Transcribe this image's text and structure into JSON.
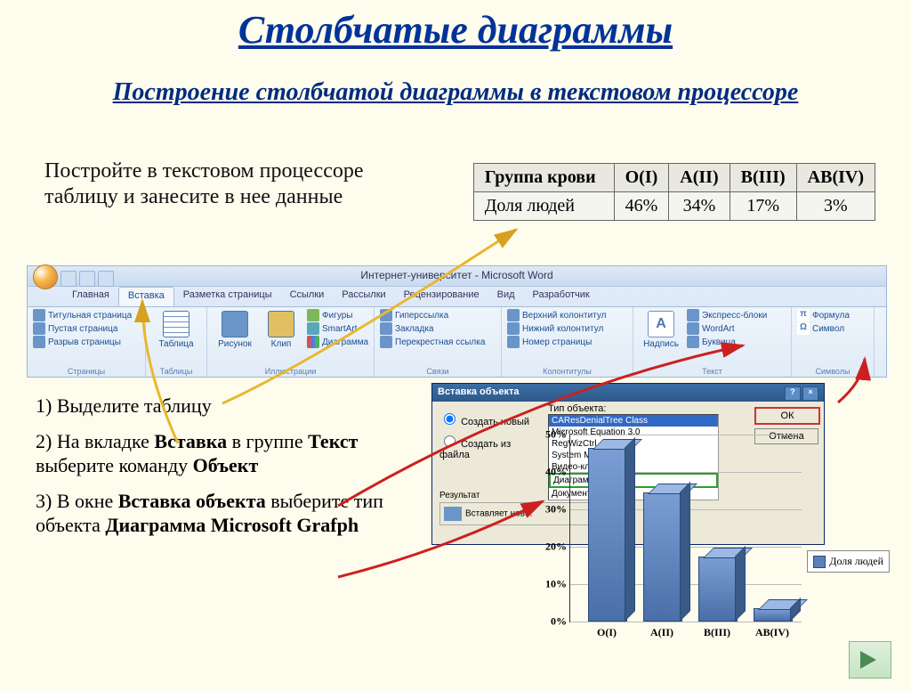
{
  "title": "Столбчатые диаграммы",
  "subtitle": "Построение столбчатой диаграммы в текстовом процессоре",
  "intro": "Постройте в текстовом процессоре таблицу и занесите в нее данные",
  "table": {
    "headers": [
      "Группа крови",
      "O(I)",
      "A(II)",
      "B(III)",
      "AB(IV)"
    ],
    "row_label": "Доля людей",
    "values": [
      "46%",
      "34%",
      "17%",
      "3%"
    ]
  },
  "word": {
    "window_title": "Интернет-университет - Microsoft Word",
    "tabs": [
      "Главная",
      "Вставка",
      "Разметка страницы",
      "Ссылки",
      "Рассылки",
      "Рецензирование",
      "Вид",
      "Разработчик"
    ],
    "groups": {
      "pages": {
        "label": "Страницы",
        "items": [
          "Титульная страница",
          "Пустая страница",
          "Разрыв страницы"
        ]
      },
      "tables": {
        "label": "Таблицы",
        "btn": "Таблица"
      },
      "illustrations": {
        "label": "Иллюстрации",
        "pic": "Рисунок",
        "clip": "Клип",
        "shapes": "Фигуры",
        "smart": "SmartArt",
        "chart": "Диаграмма"
      },
      "links": {
        "label": "Связи",
        "hyper": "Гиперссылка",
        "bookmark": "Закладка",
        "cross": "Перекрестная ссылка"
      },
      "header_footer": {
        "label": "Колонтитулы",
        "top": "Верхний колонтитул",
        "bottom": "Нижний колонтитул",
        "page": "Номер страницы"
      },
      "text": {
        "label": "Текст",
        "textbox": "Надпись",
        "quick": "Экспресс-блоки",
        "wordart": "WordArt",
        "dropcap": "Буквица"
      },
      "symbols": {
        "label": "Символы",
        "formula": "Формула",
        "symbol": "Символ"
      }
    }
  },
  "steps": {
    "s1": "1)   Выделите таблицу",
    "s2a": "2)   На вкладке ",
    "s2b": "Вставка",
    "s2c": " в группе ",
    "s2d": "Текст",
    "s2e": " выберите команду ",
    "s2f": "Объект",
    "s3a": "3)   В окне ",
    "s3b": "Вставка объекта",
    "s3c": " выберите тип объекта ",
    "s3d": "Диаграмма Microsoft Grafph"
  },
  "dialog": {
    "title": "Вставка объекта",
    "create_new": "Создать новый",
    "create_file": "Создать из файла",
    "type_label": "Тип объекта:",
    "list": [
      "CAResDenialTree Class",
      "Microsoft Equation 3.0",
      "RegWizCtrl",
      "System Monitor",
      "Видео-клип",
      "Диаграмма Mic",
      "Документ Mi"
    ],
    "ok": "ОК",
    "cancel": "Отмена",
    "result": "Результат",
    "result_text": "Вставляет нов..."
  },
  "chart_data": {
    "type": "bar",
    "categories": [
      "O(I)",
      "A(II)",
      "B(III)",
      "AB(IV)"
    ],
    "values": [
      46,
      34,
      17,
      3
    ],
    "ylim": [
      0,
      50
    ],
    "yticks": [
      "0%",
      "10%",
      "20%",
      "30%",
      "40%",
      "50%"
    ],
    "legend": "Доля людей"
  }
}
